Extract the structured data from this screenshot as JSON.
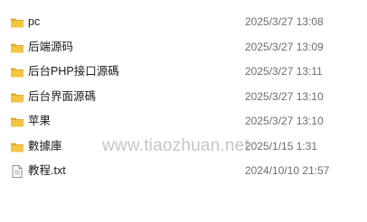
{
  "colors": {
    "folder_body": "#f4c542",
    "folder_tab": "#e3a92a",
    "name_text": "#1b1b1b",
    "date_text": "#6d6d6d",
    "watermark_text": "#a0a0a0"
  },
  "files": [
    {
      "name": "pc",
      "modified": "2025/3/27 13:08",
      "icon": "folder-icon"
    },
    {
      "name": "后端源码",
      "modified": "2025/3/27 13:09",
      "icon": "folder-icon"
    },
    {
      "name": "后台PHP接口源碼",
      "modified": "2025/3/27 13:11",
      "icon": "folder-icon"
    },
    {
      "name": "后台界面源碼",
      "modified": "2025/3/27 13:10",
      "icon": "folder-icon"
    },
    {
      "name": "苹果",
      "modified": "2025/3/27 13:10",
      "icon": "folder-icon"
    },
    {
      "name": "數據庫",
      "modified": "2025/1/15 1:31",
      "icon": "folder-icon"
    },
    {
      "name": "教程.txt",
      "modified": "2024/10/10 21:57",
      "icon": "text-file-icon"
    }
  ],
  "watermark": "www.tiaozhuan.net"
}
